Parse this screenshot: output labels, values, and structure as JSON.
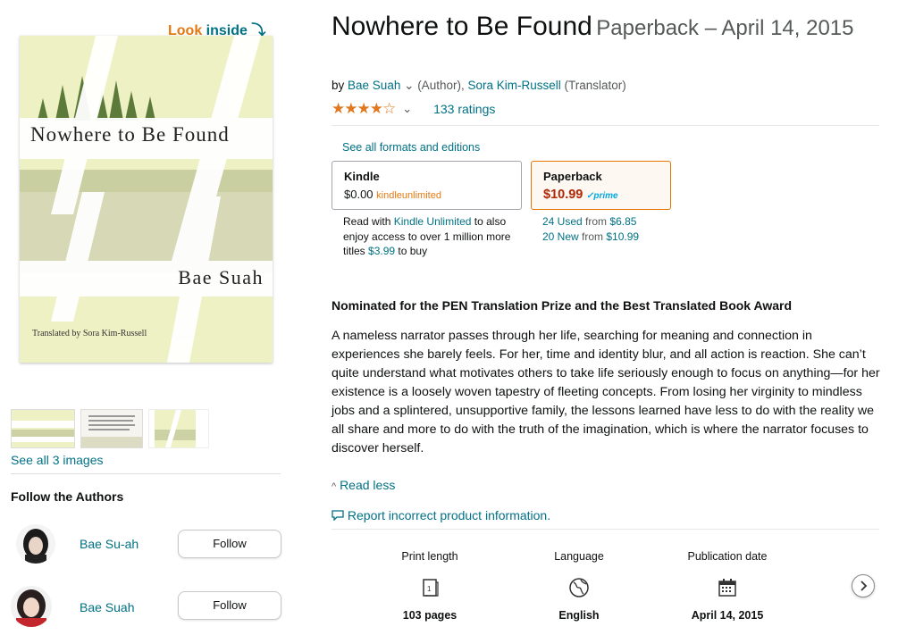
{
  "look_inside": {
    "look": "Look",
    "inside": "inside",
    "arrow": "⤵"
  },
  "cover": {
    "title": "Nowhere to Be Found",
    "author": "Bae Suah",
    "translator": "Translated by Sora Kim-Russell"
  },
  "thumbnails": {
    "see_all": "See all 3 images"
  },
  "follow": {
    "heading": "Follow the Authors",
    "authors": [
      {
        "name": "Bae Su-ah",
        "button": "Follow"
      },
      {
        "name": "Bae Suah",
        "button": "Follow"
      }
    ]
  },
  "product": {
    "title": "Nowhere to Be Found",
    "format_date": "Paperback – April 14, 2015",
    "by": "by",
    "author": "Bae Suah",
    "author_role": "(Author),",
    "translator": "Sora Kim-Russell",
    "translator_role": "(Translator)",
    "stars_display": "★★★★☆",
    "rating": 4,
    "ratings_count": "133 ratings"
  },
  "formats": {
    "see_all": "See all formats and editions",
    "kindle": {
      "name": "Kindle",
      "price": "$0.00",
      "badge": "kindleunlimited"
    },
    "paperback": {
      "name": "Paperback",
      "price": "$10.99",
      "prime": "✓prime"
    },
    "ku_text": {
      "prefix": "Read with",
      "link": "Kindle Unlimited",
      "middle": "to also enjoy access to over 1 million more titles",
      "price": "$3.99",
      "suffix": "to buy"
    },
    "used": {
      "count": "24 Used",
      "from": "from",
      "price": "$6.85"
    },
    "new": {
      "count": "20 New",
      "from": "from",
      "price": "$10.99"
    }
  },
  "description": {
    "heading": "Nominated for the PEN Translation Prize and the Best Translated Book Award",
    "body": "A nameless narrator passes through her life, searching for meaning and connection in experiences she barely feels. For her, time and identity blur, and all action is reaction. She can’t quite understand what motivates others to take life seriously enough to focus on anything—for her existence is a loosely woven tapestry of fleeting concepts. From losing her virginity to mindless jobs and a splintered, unsupportive family, the lessons learned have less to do with the reality we all share and more to do with the truth of the imagination, which is where the narrator focuses to discover herself.",
    "read_less": "Read less",
    "report": "Report incorrect product information."
  },
  "details": [
    {
      "label": "Print length",
      "value": "103 pages",
      "icon": "pages-icon"
    },
    {
      "label": "Language",
      "value": "English",
      "icon": "globe-icon"
    },
    {
      "label": "Publication date",
      "value": "April 14, 2015",
      "icon": "calendar-icon"
    }
  ],
  "colors": {
    "link": "#007185",
    "price": "#b12704",
    "star": "#de7921",
    "look_inside": "#e47911"
  }
}
